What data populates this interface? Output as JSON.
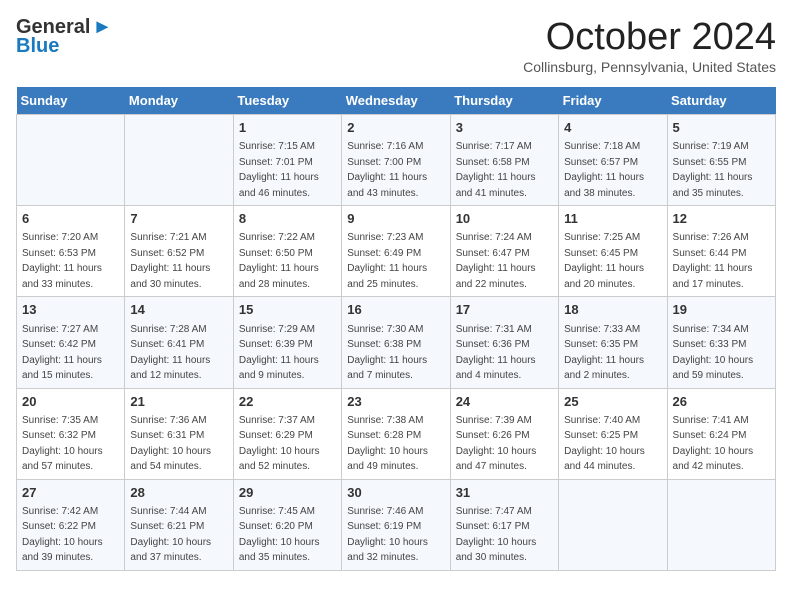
{
  "header": {
    "logo": {
      "general": "General",
      "blue": "Blue"
    },
    "title": "October 2024",
    "location": "Collinsburg, Pennsylvania, United States"
  },
  "weekdays": [
    "Sunday",
    "Monday",
    "Tuesday",
    "Wednesday",
    "Thursday",
    "Friday",
    "Saturday"
  ],
  "weeks": [
    [
      {
        "day": "",
        "sunrise": "",
        "sunset": "",
        "daylight": ""
      },
      {
        "day": "",
        "sunrise": "",
        "sunset": "",
        "daylight": ""
      },
      {
        "day": "1",
        "sunrise": "Sunrise: 7:15 AM",
        "sunset": "Sunset: 7:01 PM",
        "daylight": "Daylight: 11 hours and 46 minutes."
      },
      {
        "day": "2",
        "sunrise": "Sunrise: 7:16 AM",
        "sunset": "Sunset: 7:00 PM",
        "daylight": "Daylight: 11 hours and 43 minutes."
      },
      {
        "day": "3",
        "sunrise": "Sunrise: 7:17 AM",
        "sunset": "Sunset: 6:58 PM",
        "daylight": "Daylight: 11 hours and 41 minutes."
      },
      {
        "day": "4",
        "sunrise": "Sunrise: 7:18 AM",
        "sunset": "Sunset: 6:57 PM",
        "daylight": "Daylight: 11 hours and 38 minutes."
      },
      {
        "day": "5",
        "sunrise": "Sunrise: 7:19 AM",
        "sunset": "Sunset: 6:55 PM",
        "daylight": "Daylight: 11 hours and 35 minutes."
      }
    ],
    [
      {
        "day": "6",
        "sunrise": "Sunrise: 7:20 AM",
        "sunset": "Sunset: 6:53 PM",
        "daylight": "Daylight: 11 hours and 33 minutes."
      },
      {
        "day": "7",
        "sunrise": "Sunrise: 7:21 AM",
        "sunset": "Sunset: 6:52 PM",
        "daylight": "Daylight: 11 hours and 30 minutes."
      },
      {
        "day": "8",
        "sunrise": "Sunrise: 7:22 AM",
        "sunset": "Sunset: 6:50 PM",
        "daylight": "Daylight: 11 hours and 28 minutes."
      },
      {
        "day": "9",
        "sunrise": "Sunrise: 7:23 AM",
        "sunset": "Sunset: 6:49 PM",
        "daylight": "Daylight: 11 hours and 25 minutes."
      },
      {
        "day": "10",
        "sunrise": "Sunrise: 7:24 AM",
        "sunset": "Sunset: 6:47 PM",
        "daylight": "Daylight: 11 hours and 22 minutes."
      },
      {
        "day": "11",
        "sunrise": "Sunrise: 7:25 AM",
        "sunset": "Sunset: 6:45 PM",
        "daylight": "Daylight: 11 hours and 20 minutes."
      },
      {
        "day": "12",
        "sunrise": "Sunrise: 7:26 AM",
        "sunset": "Sunset: 6:44 PM",
        "daylight": "Daylight: 11 hours and 17 minutes."
      }
    ],
    [
      {
        "day": "13",
        "sunrise": "Sunrise: 7:27 AM",
        "sunset": "Sunset: 6:42 PM",
        "daylight": "Daylight: 11 hours and 15 minutes."
      },
      {
        "day": "14",
        "sunrise": "Sunrise: 7:28 AM",
        "sunset": "Sunset: 6:41 PM",
        "daylight": "Daylight: 11 hours and 12 minutes."
      },
      {
        "day": "15",
        "sunrise": "Sunrise: 7:29 AM",
        "sunset": "Sunset: 6:39 PM",
        "daylight": "Daylight: 11 hours and 9 minutes."
      },
      {
        "day": "16",
        "sunrise": "Sunrise: 7:30 AM",
        "sunset": "Sunset: 6:38 PM",
        "daylight": "Daylight: 11 hours and 7 minutes."
      },
      {
        "day": "17",
        "sunrise": "Sunrise: 7:31 AM",
        "sunset": "Sunset: 6:36 PM",
        "daylight": "Daylight: 11 hours and 4 minutes."
      },
      {
        "day": "18",
        "sunrise": "Sunrise: 7:33 AM",
        "sunset": "Sunset: 6:35 PM",
        "daylight": "Daylight: 11 hours and 2 minutes."
      },
      {
        "day": "19",
        "sunrise": "Sunrise: 7:34 AM",
        "sunset": "Sunset: 6:33 PM",
        "daylight": "Daylight: 10 hours and 59 minutes."
      }
    ],
    [
      {
        "day": "20",
        "sunrise": "Sunrise: 7:35 AM",
        "sunset": "Sunset: 6:32 PM",
        "daylight": "Daylight: 10 hours and 57 minutes."
      },
      {
        "day": "21",
        "sunrise": "Sunrise: 7:36 AM",
        "sunset": "Sunset: 6:31 PM",
        "daylight": "Daylight: 10 hours and 54 minutes."
      },
      {
        "day": "22",
        "sunrise": "Sunrise: 7:37 AM",
        "sunset": "Sunset: 6:29 PM",
        "daylight": "Daylight: 10 hours and 52 minutes."
      },
      {
        "day": "23",
        "sunrise": "Sunrise: 7:38 AM",
        "sunset": "Sunset: 6:28 PM",
        "daylight": "Daylight: 10 hours and 49 minutes."
      },
      {
        "day": "24",
        "sunrise": "Sunrise: 7:39 AM",
        "sunset": "Sunset: 6:26 PM",
        "daylight": "Daylight: 10 hours and 47 minutes."
      },
      {
        "day": "25",
        "sunrise": "Sunrise: 7:40 AM",
        "sunset": "Sunset: 6:25 PM",
        "daylight": "Daylight: 10 hours and 44 minutes."
      },
      {
        "day": "26",
        "sunrise": "Sunrise: 7:41 AM",
        "sunset": "Sunset: 6:24 PM",
        "daylight": "Daylight: 10 hours and 42 minutes."
      }
    ],
    [
      {
        "day": "27",
        "sunrise": "Sunrise: 7:42 AM",
        "sunset": "Sunset: 6:22 PM",
        "daylight": "Daylight: 10 hours and 39 minutes."
      },
      {
        "day": "28",
        "sunrise": "Sunrise: 7:44 AM",
        "sunset": "Sunset: 6:21 PM",
        "daylight": "Daylight: 10 hours and 37 minutes."
      },
      {
        "day": "29",
        "sunrise": "Sunrise: 7:45 AM",
        "sunset": "Sunset: 6:20 PM",
        "daylight": "Daylight: 10 hours and 35 minutes."
      },
      {
        "day": "30",
        "sunrise": "Sunrise: 7:46 AM",
        "sunset": "Sunset: 6:19 PM",
        "daylight": "Daylight: 10 hours and 32 minutes."
      },
      {
        "day": "31",
        "sunrise": "Sunrise: 7:47 AM",
        "sunset": "Sunset: 6:17 PM",
        "daylight": "Daylight: 10 hours and 30 minutes."
      },
      {
        "day": "",
        "sunrise": "",
        "sunset": "",
        "daylight": ""
      },
      {
        "day": "",
        "sunrise": "",
        "sunset": "",
        "daylight": ""
      }
    ]
  ]
}
